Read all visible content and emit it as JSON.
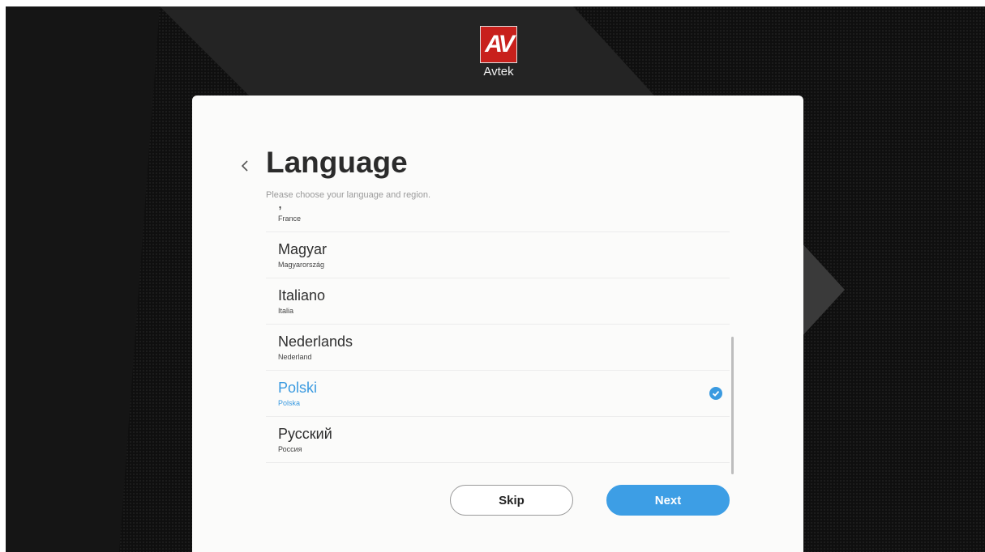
{
  "brand": {
    "logo_mark": "AV",
    "name": "Avtek",
    "logo_color": "#c8201c"
  },
  "header": {
    "back_icon": "chevron-left-icon",
    "title": "Language",
    "subtitle": "Please choose your language and region."
  },
  "languages": {
    "items": [
      {
        "name": ",",
        "region": "France"
      },
      {
        "name": "Magyar",
        "region": "Magyarország"
      },
      {
        "name": "Italiano",
        "region": "Italia"
      },
      {
        "name": "Nederlands",
        "region": "Nederland"
      },
      {
        "name": "Polski",
        "region": "Polska",
        "selected": true
      },
      {
        "name": "Русский",
        "region": "Россия"
      }
    ],
    "selected_icon": "check-circle-icon",
    "accent_color": "#3a9ae0"
  },
  "actions": {
    "skip_label": "Skip",
    "next_label": "Next"
  }
}
